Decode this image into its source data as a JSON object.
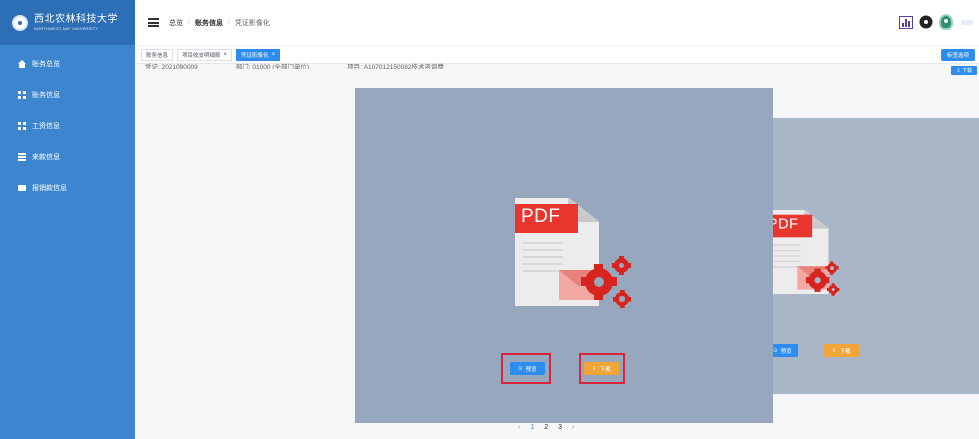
{
  "app": {
    "logo_cn": "西北农林科技大学",
    "logo_en": "NORTHWEST A&F UNIVERSITY"
  },
  "sidebar": {
    "items": [
      {
        "label": "账务总览",
        "icon": "home-icon"
      },
      {
        "label": "账务信息",
        "icon": "grid-icon"
      },
      {
        "label": "工资信息",
        "icon": "grid-icon"
      },
      {
        "label": "来款信息",
        "icon": "list-icon"
      },
      {
        "label": "报销款信息",
        "icon": "card-icon"
      }
    ]
  },
  "header": {
    "breadcrumb": [
      "总览",
      "账务信息",
      "凭证影像化"
    ],
    "icons": [
      "chart-icon",
      "gear-icon",
      "avatar"
    ]
  },
  "tags": {
    "items": [
      {
        "label": "账务信息",
        "closable": false,
        "active": false
      },
      {
        "label": "项目收支明细账",
        "closable": true,
        "active": false
      },
      {
        "label": "凭证影像化",
        "closable": true,
        "active": true
      }
    ],
    "close_glyph": "×",
    "options_label": "标签选项"
  },
  "content": {
    "info": [
      "凭证: 2021090009",
      "部门: 01000 (全部门单位)",
      "项目: A107012150082技术咨询费"
    ],
    "download_top": "⇩ 下载",
    "pdf_label": "PDF",
    "preview_label": "预览",
    "download_label": "下载",
    "preview_icon": "eye-icon",
    "download_icon": "download-icon"
  },
  "pager": {
    "prev": "‹",
    "pages": [
      "1",
      "2",
      "3"
    ],
    "current": "1",
    "next": "›"
  },
  "colors": {
    "sidebar": "#3d86cf",
    "primary": "#2d8cf0",
    "download": "#f0a534",
    "highlight": "#d9263d",
    "card": "#97a7bd"
  }
}
